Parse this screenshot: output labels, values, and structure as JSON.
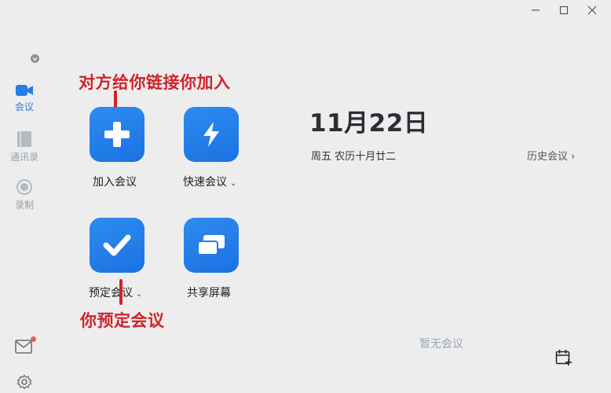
{
  "window": {
    "controls": [
      "minimize",
      "maximize",
      "close"
    ]
  },
  "sidebar": {
    "items": [
      {
        "label": "会议",
        "icon": "video-camera-icon",
        "active": true
      },
      {
        "label": "通讯录",
        "icon": "contacts-book-icon",
        "active": false
      },
      {
        "label": "录制",
        "icon": "record-icon",
        "active": false
      }
    ],
    "bottom": [
      {
        "icon": "mail-icon",
        "has_notification": true
      },
      {
        "icon": "gear-icon"
      }
    ]
  },
  "actions": [
    {
      "label": "加入会议",
      "icon": "plus-icon",
      "has_dropdown": false
    },
    {
      "label": "快速会议",
      "icon": "lightning-icon",
      "has_dropdown": true
    },
    {
      "label": "预定会议",
      "icon": "check-icon",
      "has_dropdown": true
    },
    {
      "label": "共享屏幕",
      "icon": "share-screen-icon",
      "has_dropdown": false
    }
  ],
  "annotations": {
    "top": "对方给你链接你加入",
    "bottom": "你预定会议"
  },
  "calendar": {
    "date": "11月22日",
    "sub": "周五 农历十月廿二",
    "history_label": "历史会议",
    "empty_label": "暂无会议"
  },
  "colors": {
    "accent": "#2a7de1",
    "tile": "#1f7fe8",
    "annotation": "#d0232b",
    "background": "#ededed"
  }
}
